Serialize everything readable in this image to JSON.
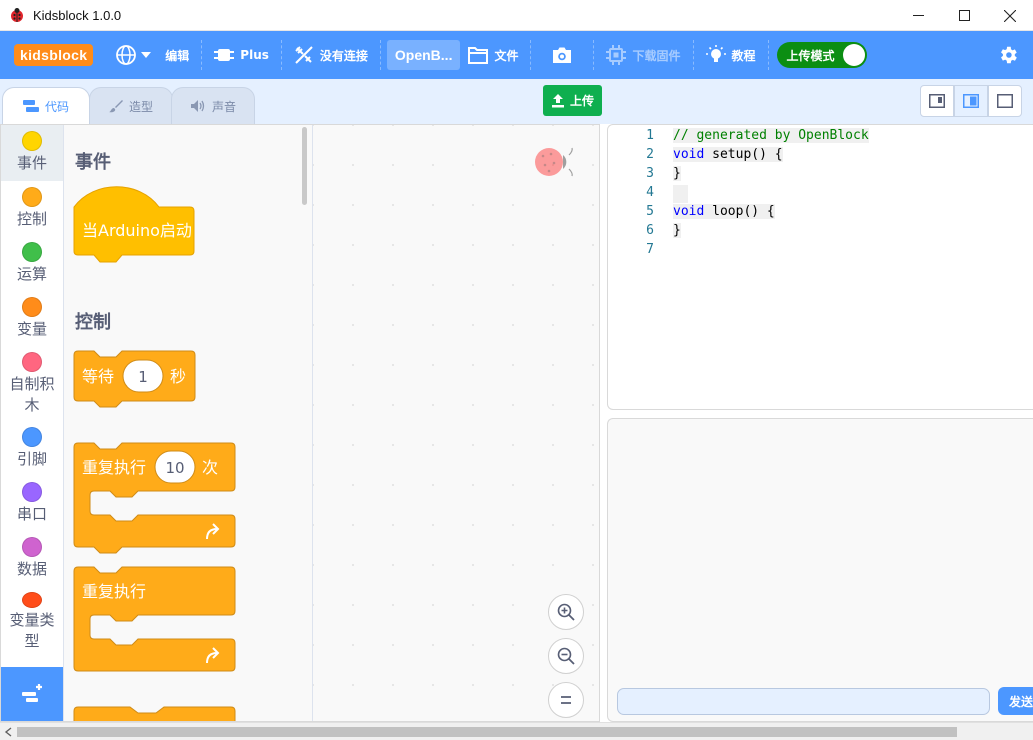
{
  "window": {
    "title": "Kidsblock 1.0.0"
  },
  "menubar": {
    "logo": "kidsblock",
    "edit": "编辑",
    "plus": "Plus",
    "connection": "没有连接",
    "board": "OpenB...",
    "file": "文件",
    "download_firmware": "下载固件",
    "tutorial": "教程",
    "upload_mode": "上传模式",
    "upload_mode_on": true
  },
  "tabs": {
    "code": "代码",
    "costume": "造型",
    "sound": "声音"
  },
  "upload_button": "上传",
  "categories": [
    {
      "name": "事件",
      "color": "#ffd500"
    },
    {
      "name": "控制",
      "color": "#ffab19"
    },
    {
      "name": "运算",
      "color": "#40bf4a"
    },
    {
      "name": "变量",
      "color": "#ff8c1a"
    },
    {
      "name": "自制积木",
      "color": "#ff6680"
    },
    {
      "name": "引脚",
      "color": "#4c97ff"
    },
    {
      "name": "串口",
      "color": "#9966ff"
    },
    {
      "name": "数据",
      "color": "#cf63cf"
    },
    {
      "name": "变量类型",
      "color": "#ff4d1a"
    }
  ],
  "flyout": {
    "events_title": "事件",
    "when_start": "当Arduino启动",
    "control_title": "控制",
    "wait_label": "等待",
    "wait_value": "1",
    "wait_unit": "秒",
    "repeat_label": "重复执行",
    "repeat_value": "10",
    "repeat_unit": "次",
    "forever_label": "重复执行"
  },
  "code": {
    "lines": [
      {
        "n": "1",
        "parts": [
          {
            "t": "// generated by OpenBlock",
            "c": "cm"
          }
        ]
      },
      {
        "n": "2",
        "parts": [
          {
            "t": "void",
            "c": "kw"
          },
          {
            "t": " setup() {",
            "c": ""
          }
        ]
      },
      {
        "n": "3",
        "parts": [
          {
            "t": "}",
            "c": ""
          }
        ]
      },
      {
        "n": "4",
        "parts": []
      },
      {
        "n": "5",
        "parts": [
          {
            "t": "void",
            "c": "kw"
          },
          {
            "t": " loop() {",
            "c": ""
          }
        ]
      },
      {
        "n": "6",
        "parts": [
          {
            "t": "}",
            "c": ""
          }
        ]
      },
      {
        "n": "7",
        "parts": []
      }
    ]
  },
  "serial": {
    "send": "发送",
    "input_value": ""
  }
}
